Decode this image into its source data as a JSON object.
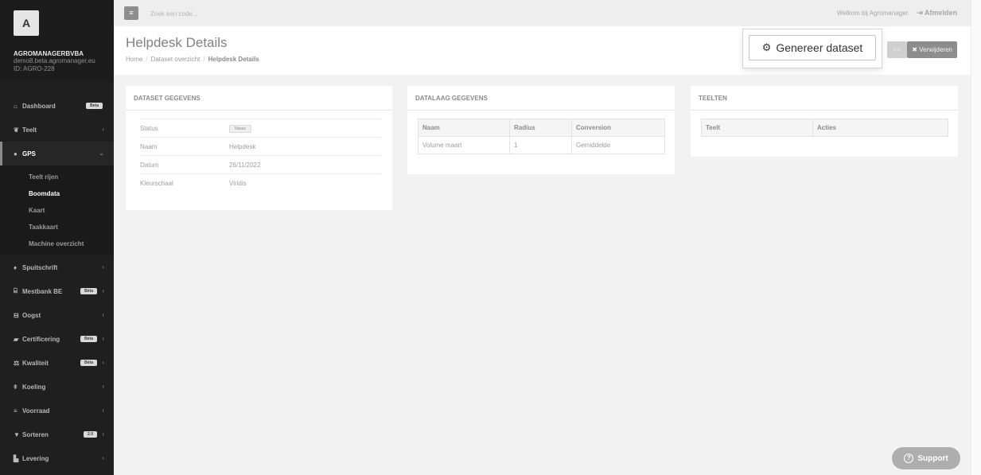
{
  "sidebar": {
    "avatar_letter": "A",
    "company": "AGROMANAGERBVBA",
    "email": "demo8.beta.agromanager.eu",
    "account_id": "ID: AGRO-228",
    "items": [
      {
        "label": "Dashboard",
        "icon": "home-icon",
        "badge": "Beta"
      },
      {
        "label": "Teelt",
        "icon": "leaf-icon",
        "chevron": "‹"
      },
      {
        "label": "GPS",
        "icon": "map-marker-icon",
        "chevron": "⌄"
      },
      {
        "label": "Spuitschrift",
        "icon": "droplet-icon",
        "chevron": "‹"
      },
      {
        "label": "Mestbank BE",
        "icon": "bank-icon",
        "badge": "Bèta",
        "chevron": "‹"
      },
      {
        "label": "Oogst",
        "icon": "basket-icon",
        "chevron": "‹"
      },
      {
        "label": "Certificering",
        "icon": "certificate-icon",
        "badge": "Bèta",
        "chevron": "‹"
      },
      {
        "label": "Kwaliteit",
        "icon": "balance-scale-icon",
        "badge": "Bèta",
        "chevron": "‹"
      },
      {
        "label": "Koeling",
        "icon": "thermometer-icon",
        "chevron": "‹"
      },
      {
        "label": "Voorraad",
        "icon": "list-icon",
        "chevron": "‹"
      },
      {
        "label": "Sorteren",
        "icon": "filter-icon",
        "badge": "2.0",
        "chevron": "‹"
      },
      {
        "label": "Levering",
        "icon": "truck-icon",
        "chevron": "‹"
      }
    ],
    "gps_submenu": [
      "Teelt rijen",
      "Boomdata",
      "Kaart",
      "Taakkaart",
      "Machine overzicht"
    ]
  },
  "topbar": {
    "menu_icon": "hamburger-icon",
    "search_placeholder": "Zoek een code...",
    "welcome": "Welkom bij Agromanager.",
    "logout_icon": "sign-out-icon",
    "logout": "Afmelden"
  },
  "header": {
    "title": "Helpdesk Details",
    "breadcrumb": [
      "Home",
      "Dataset overzicht",
      "Helpdesk Details"
    ],
    "hidden_button_fragment": "en",
    "delete_icon": "close-icon",
    "delete_label": "Verwijderen"
  },
  "spotlight": {
    "icon": "cogs-icon",
    "label": "Genereer dataset"
  },
  "dataset": {
    "title": "DATASET GEGEVENS",
    "rows": [
      {
        "key": "Status",
        "value": "Nieuw"
      },
      {
        "key": "Naam",
        "value": "Helpdesk"
      },
      {
        "key": "Datum",
        "value": "26/11/2022"
      },
      {
        "key": "Kleurschaal",
        "value": "Viridis"
      }
    ]
  },
  "datalaag": {
    "title": "DATALAAG GEGEVENS",
    "headers": [
      "Naam",
      "Radius",
      "Conversion"
    ],
    "rows": [
      [
        "Volume maart",
        "1",
        "Gemiddelde"
      ]
    ]
  },
  "teelten": {
    "title": "TEELTEN",
    "headers": [
      "Teelt",
      "Acties"
    ]
  },
  "support": {
    "icon": "question-circle-icon",
    "label": "Support"
  }
}
